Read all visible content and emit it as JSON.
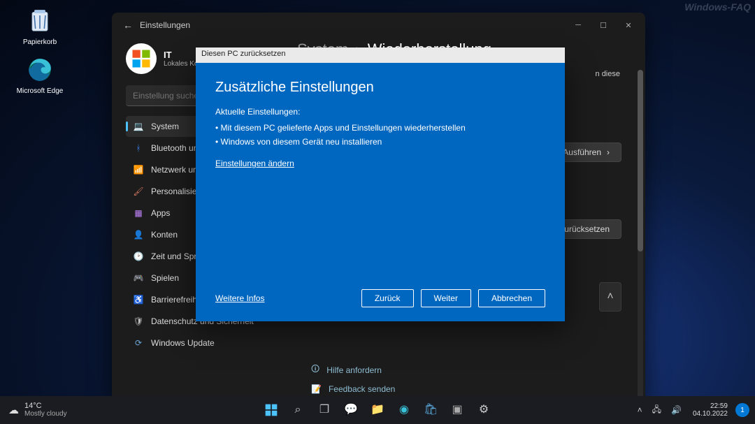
{
  "watermark": "Windows-FAQ",
  "desktop": {
    "recycle_bin": "Papierkorb",
    "edge": "Microsoft Edge"
  },
  "settings": {
    "app_title": "Einstellungen",
    "profile": {
      "name": "IT",
      "subtitle": "Lokales Konto"
    },
    "search_placeholder": "Einstellung suchen",
    "nav": [
      {
        "label": "System",
        "icon": "💻",
        "color": "#60a5fa",
        "active": true
      },
      {
        "label": "Bluetooth und Geräte",
        "icon": "ᚼ",
        "color": "#3b82f6"
      },
      {
        "label": "Netzwerk und Internet",
        "icon": "📶",
        "color": "#3bb4c1"
      },
      {
        "label": "Personalisierung",
        "icon": "🖌",
        "color": "#d9785f"
      },
      {
        "label": "Apps",
        "icon": "▦",
        "color": "#c084fc"
      },
      {
        "label": "Konten",
        "icon": "👤",
        "color": "#6bcf8f"
      },
      {
        "label": "Zeit und Sprache",
        "icon": "🕑",
        "color": "#bdbdbd"
      },
      {
        "label": "Spielen",
        "icon": "🎮",
        "color": "#bdbdbd"
      },
      {
        "label": "Barrierefreiheit",
        "icon": "♿",
        "color": "#6aa6d8"
      },
      {
        "label": "Datenschutz und Sicherheit",
        "icon": "🛡",
        "color": "#bdbdbd"
      },
      {
        "label": "Windows Update",
        "icon": "⟳",
        "color": "#6aa6d8"
      }
    ],
    "breadcrumb": {
      "a": "System",
      "sep": "›",
      "b": "Wiederherstellung"
    },
    "hint_text": "n diese",
    "run_button": "Ausführen",
    "reset_button": "zurücksetzen",
    "help": "Hilfe anfordern",
    "feedback": "Feedback senden"
  },
  "dialog": {
    "title": "Diesen PC zurücksetzen",
    "heading": "Zusätzliche Einstellungen",
    "subheading": "Aktuelle Einstellungen:",
    "items": [
      "Mit diesem PC gelieferte Apps und Einstellungen wiederherstellen",
      "Windows von diesem Gerät neu installieren"
    ],
    "change": "Einstellungen ändern",
    "more": "Weitere Infos",
    "back": "Zurück",
    "next": "Weiter",
    "cancel": "Abbrechen"
  },
  "taskbar": {
    "weather": {
      "temp": "14°C",
      "desc": "Mostly cloudy"
    },
    "clock": {
      "time": "22:59",
      "date": "04.10.2022"
    },
    "notif": "1"
  }
}
